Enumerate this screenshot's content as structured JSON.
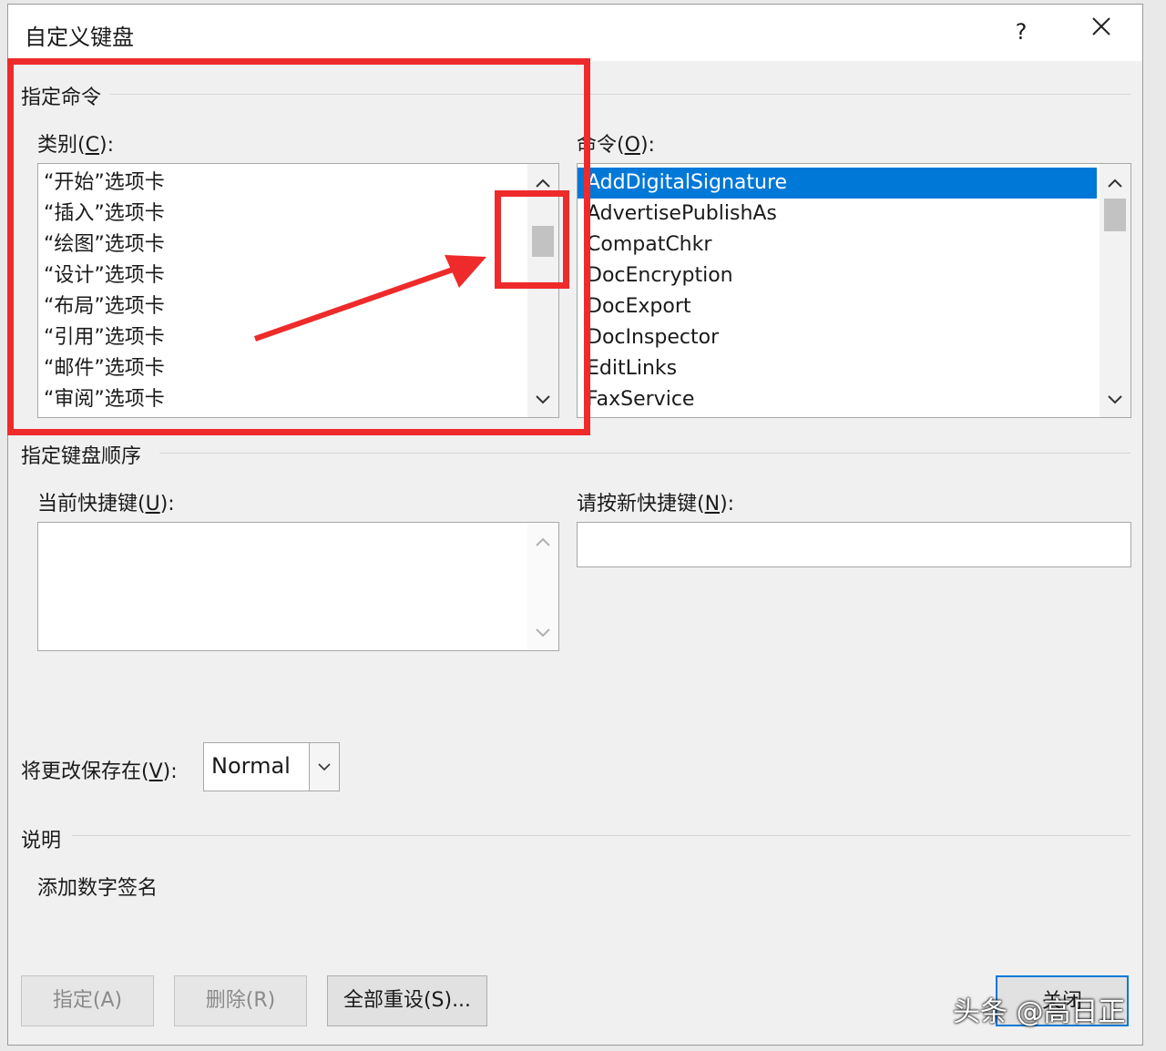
{
  "dialog": {
    "title": "自定义键盘",
    "help_label": "?"
  },
  "assign_command": {
    "group_label": "指定命令",
    "categories": {
      "label": "类别",
      "accel": "C",
      "items": [
        "“开始”选项卡",
        "“插入”选项卡",
        "“绘图”选项卡",
        "“设计”选项卡",
        "“布局”选项卡",
        "“引用”选项卡",
        "“邮件”选项卡",
        "“审阅”选项卡"
      ]
    },
    "commands": {
      "label": "命令",
      "accel": "O",
      "items": [
        "AddDigitalSignature",
        "AdvertisePublishAs",
        "CompatChkr",
        "DocEncryption",
        "DocExport",
        "DocInspector",
        "EditLinks",
        "FaxService"
      ],
      "selected_index": 0
    }
  },
  "assign_keys": {
    "group_label": "指定键盘顺序",
    "current_keys": {
      "label": "当前快捷键",
      "accel": "U"
    },
    "new_key": {
      "label": "请按新快捷键",
      "accel": "N",
      "value": ""
    }
  },
  "save_in": {
    "label": "将更改保存在",
    "accel": "V",
    "value": "Normal"
  },
  "description": {
    "group_label": "说明",
    "text": "添加数字签名"
  },
  "buttons": {
    "assign": "指定(A)",
    "remove": "删除(R)",
    "reset_all": "全部重设(S)...",
    "close": "关闭"
  },
  "watermark": "头条 @高日正",
  "annotation_color": "#ee2a2a",
  "accent_color": "#0078d7"
}
